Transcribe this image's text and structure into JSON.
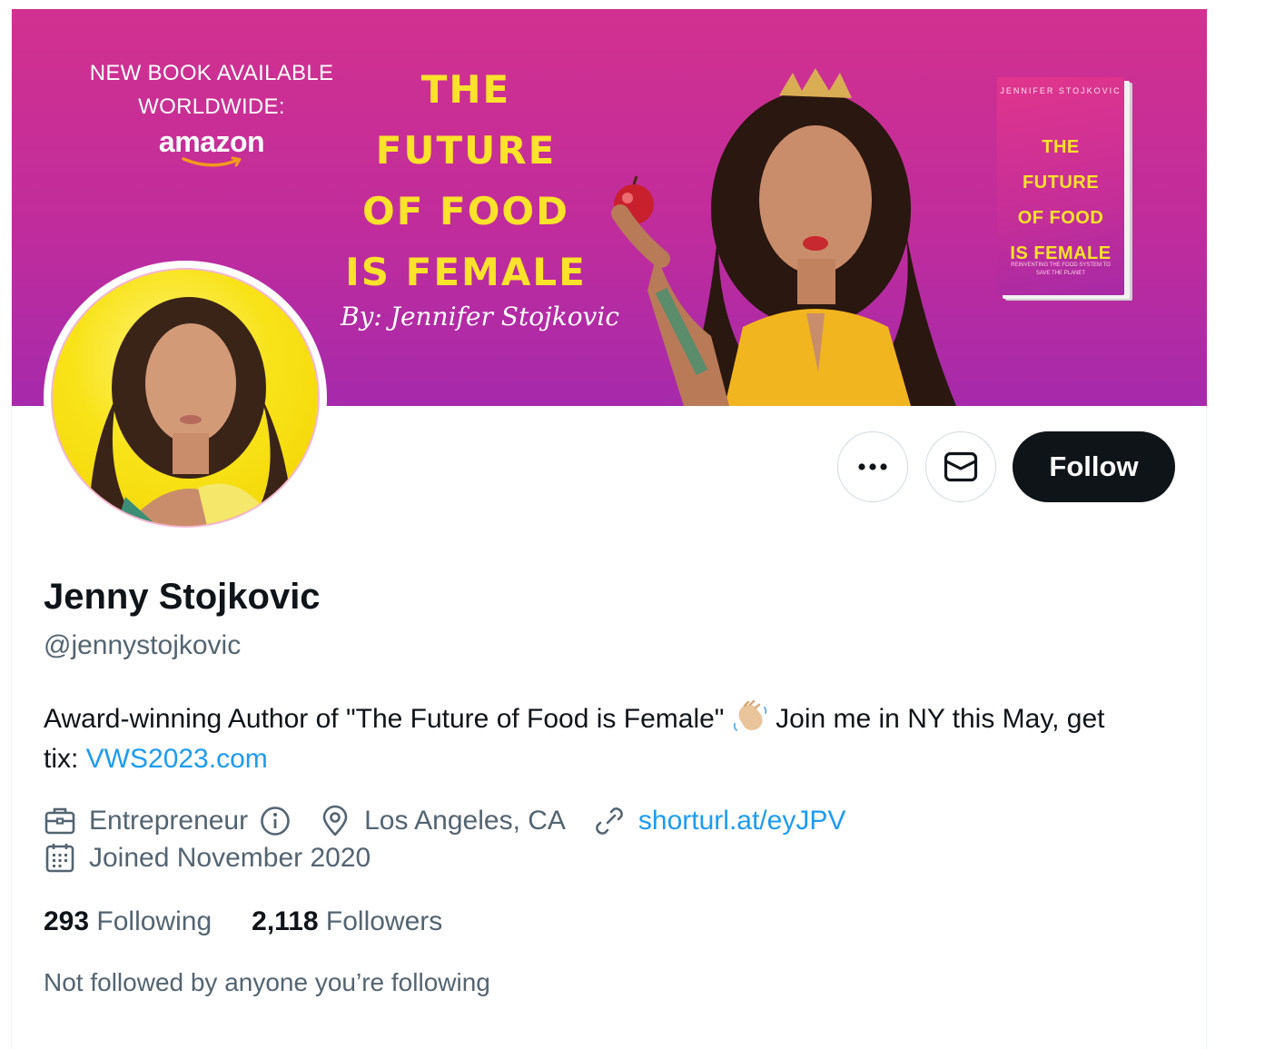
{
  "banner": {
    "promo_line1": "NEW BOOK AVAILABLE",
    "promo_line2": "WORLDWIDE:",
    "amazon_logo": "amazon",
    "title_lines": [
      "THE",
      "FUTURE",
      "OF FOOD",
      "IS FEMALE"
    ],
    "byline": "By: Jennifer Stojkovic",
    "book_author": "JENNIFER STOJKOVIC",
    "book_title_lines": [
      "THE",
      "FUTURE",
      "OF FOOD",
      "IS FEMALE"
    ],
    "book_subtitle": "REINVENTING THE FOOD SYSTEM TO SAVE THE PLANET",
    "colors": {
      "background": "#c52e98",
      "title": "#fbe22b"
    }
  },
  "profile": {
    "display_name": "Jenny Stojkovic",
    "handle": "@jennystojkovic",
    "bio_text_1": "Award-winning Author of \"The Future of Food is Female\"",
    "bio_emoji": "waving-hand-emoji",
    "bio_text_2": " Join me in NY this May, get tix: ",
    "bio_link": "VWS2023.com",
    "category": "Entrepreneur",
    "location": "Los Angeles, CA",
    "website": "shorturl.at/eyJPV",
    "joined": "Joined November 2020"
  },
  "actions": {
    "more_icon": "ellipsis-icon",
    "message_icon": "mail-icon",
    "follow_label": "Follow"
  },
  "stats": {
    "following_count": "293",
    "following_label": "Following",
    "followers_count": "2,118",
    "followers_label": "Followers"
  },
  "social_context": "Not followed by anyone you’re following",
  "colors": {
    "accent": "#1d9bf0",
    "text_primary": "#0f1419",
    "text_secondary": "#536471",
    "follow_button": "#0f1419"
  }
}
